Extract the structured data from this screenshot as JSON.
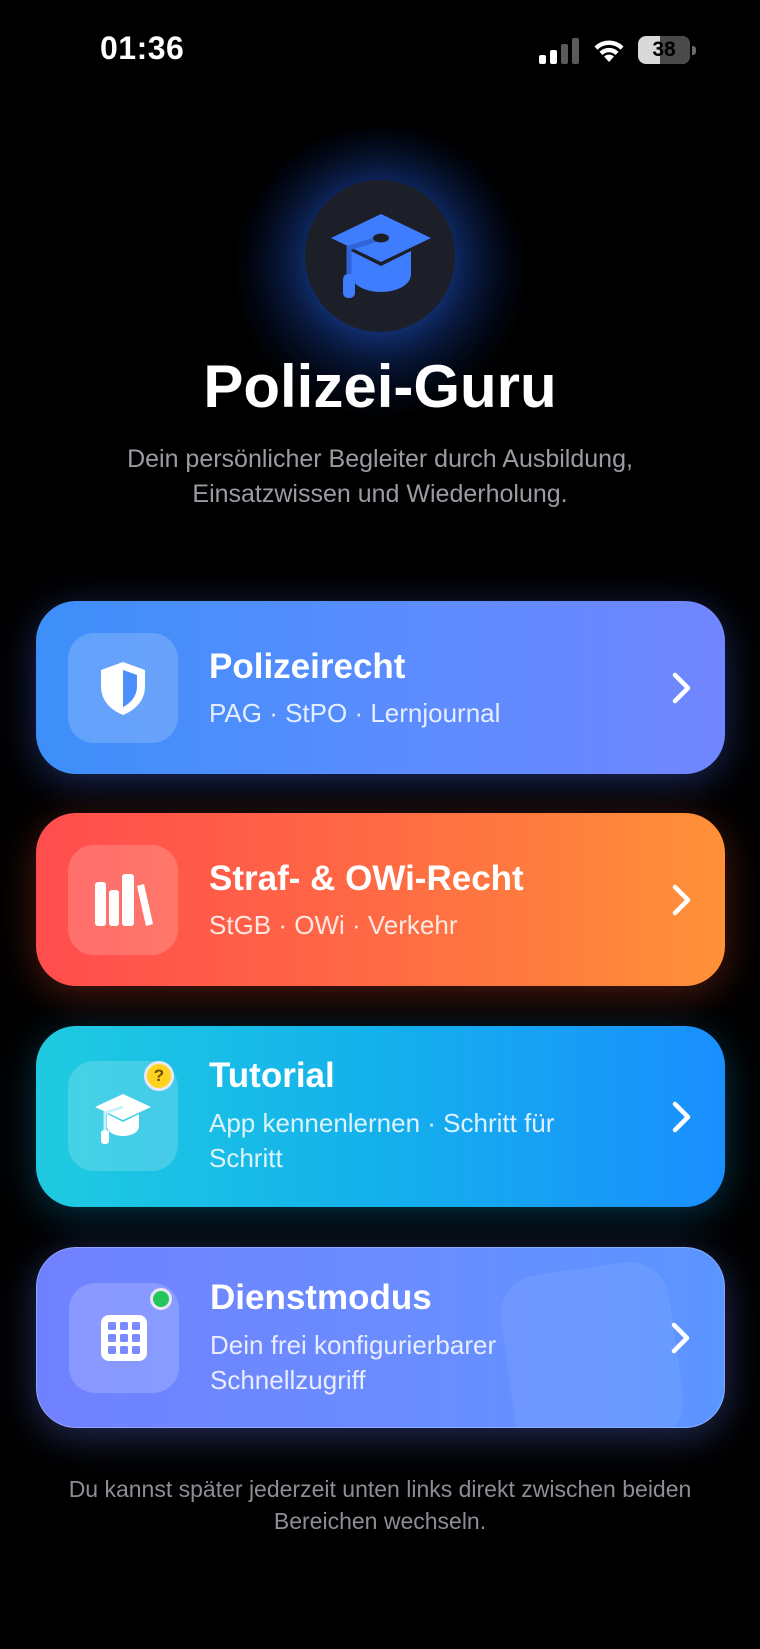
{
  "status_bar": {
    "time": "01:36",
    "battery_level": "38"
  },
  "hero": {
    "icon": "graduation-cap-icon",
    "accent_color": "#3f7dff",
    "title": "Polizei-Guru",
    "subtitle": "Dein persönlicher Begleiter durch Ausbildung, Einsatzwissen und Wiederholung."
  },
  "cards": [
    {
      "title": "Polizeirecht",
      "subtitle": "PAG · StPO · Lernjournal",
      "icon": "shield-icon",
      "gradient": [
        "#3d8ff9",
        "#7186ff"
      ]
    },
    {
      "title": "Straf- & OWi-Recht",
      "subtitle": "StGB · OWi · Verkehr",
      "icon": "books-icon",
      "gradient": [
        "#ff4d4d",
        "#ff9138"
      ]
    },
    {
      "title": "Tutorial",
      "subtitle": "App kennenlernen · Schritt für Schritt",
      "icon": "graduation-cap-icon",
      "badge": "?",
      "gradient": [
        "#1fcbe0",
        "#1a8fff"
      ]
    },
    {
      "title": "Dienstmodus",
      "subtitle": "Dein frei konfigurierbarer Schnellzugriff",
      "icon": "grid-calculator-icon",
      "status_dot_color": "#22c55e",
      "gradient": [
        "#7081ff",
        "#5b95ff"
      ]
    }
  ],
  "footer": {
    "note": "Du kannst später jederzeit unten links direkt zwischen beiden Bereichen wechseln."
  }
}
